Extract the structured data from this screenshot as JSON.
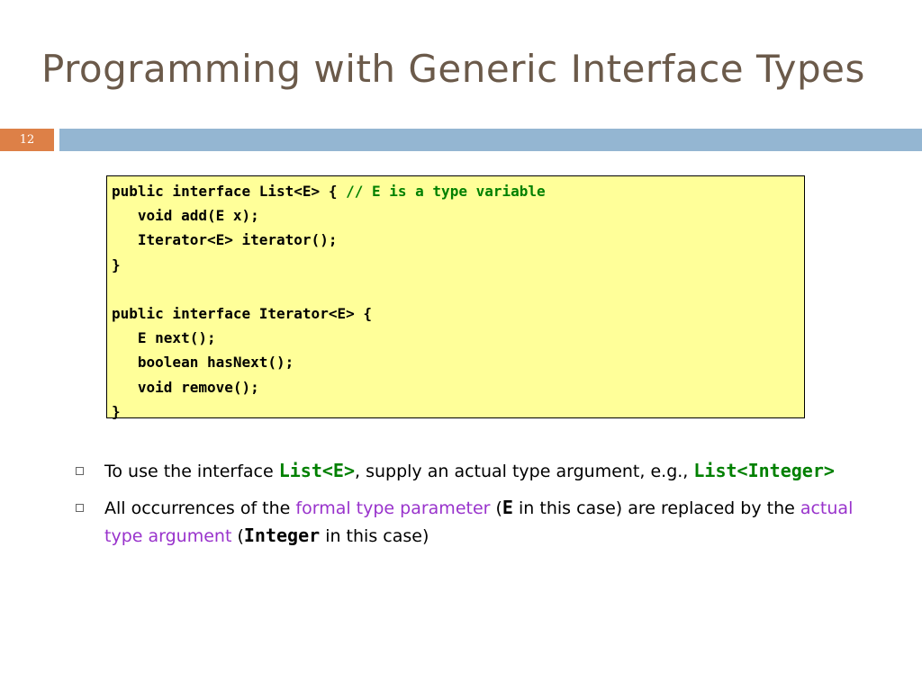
{
  "slide": {
    "title": "Programming with Generic Interface Types",
    "number": "12",
    "accent_color": "#dd8047",
    "bar_color": "#94b6d2"
  },
  "code": {
    "background": "#ffff99",
    "lines": [
      {
        "code": "public interface List<E> { ",
        "comment": "// E is a type variable"
      },
      {
        "code": "   void add(E x);",
        "comment": ""
      },
      {
        "code": "   Iterator<E> iterator();",
        "comment": ""
      },
      {
        "code": "}",
        "comment": ""
      },
      {
        "code": "",
        "comment": ""
      },
      {
        "code": "public interface Iterator<E> {",
        "comment": ""
      },
      {
        "code": "   E next();",
        "comment": ""
      },
      {
        "code": "   boolean hasNext();",
        "comment": ""
      },
      {
        "code": "   void remove();",
        "comment": ""
      },
      {
        "code": "}",
        "comment": ""
      }
    ]
  },
  "bullets": [
    {
      "parts": [
        {
          "t": "To use the interface ",
          "s": "normal"
        },
        {
          "t": "List<E>",
          "s": "mono-green"
        },
        {
          "t": ", supply an actual type argument, e.g., ",
          "s": "normal"
        },
        {
          "t": "List<Integer>",
          "s": "mono-green"
        }
      ]
    },
    {
      "parts": [
        {
          "t": "All occurrences of the ",
          "s": "normal"
        },
        {
          "t": "formal type parameter",
          "s": "purple"
        },
        {
          "t": " (",
          "s": "normal"
        },
        {
          "t": "E",
          "s": "mono-black"
        },
        {
          "t": " in this case) are replaced by the ",
          "s": "normal"
        },
        {
          "t": "actual type argument",
          "s": "purple"
        },
        {
          "t": " (",
          "s": "normal"
        },
        {
          "t": "Integer",
          "s": "mono-black"
        },
        {
          "t": " in this case)",
          "s": "normal"
        }
      ]
    }
  ]
}
